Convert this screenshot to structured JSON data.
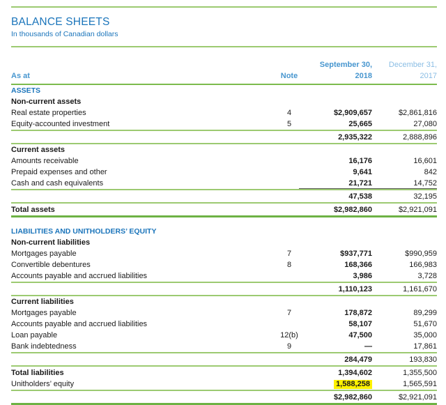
{
  "page": {
    "title": "BALANCE SHEETS",
    "subtitle": "In thousands of Canadian dollars"
  },
  "colors": {
    "accent_blue": "#1b75bb",
    "header_blue": "#4796cf",
    "header_blue_light": "#8abde4",
    "rule_green": "#9cca71",
    "rule_green_dark": "#6db244",
    "highlight_yellow": "#fff200",
    "text": "#1a1a1a"
  },
  "table": {
    "header": {
      "as_at": "As at",
      "note": "Note",
      "col_date_2018": "September 30,",
      "col_date_2017": "December 31,",
      "year_2018": "2018",
      "year_2017": "2017"
    },
    "rows": [
      {
        "type": "section",
        "label": "ASSETS"
      },
      {
        "type": "subhead",
        "label": "Non-current assets"
      },
      {
        "type": "item",
        "label": "Real estate properties",
        "note": "4",
        "v2018": "$2,909,657",
        "v2017": "$2,861,816"
      },
      {
        "type": "item",
        "label": "Equity-accounted investment",
        "note": "5",
        "v2018": "25,665",
        "v2017": "27,080"
      },
      {
        "type": "divider",
        "style": "thin"
      },
      {
        "type": "subtotal",
        "v2018": "2,935,322",
        "v2017": "2,888,896"
      },
      {
        "type": "divider",
        "style": "thin"
      },
      {
        "type": "subhead",
        "label": "Current assets"
      },
      {
        "type": "item",
        "label": "Amounts receivable",
        "v2018": "16,176",
        "v2017": "16,601"
      },
      {
        "type": "item",
        "label": "Prepaid expenses and other",
        "v2018": "9,641",
        "v2017": "842"
      },
      {
        "type": "item",
        "label": "Cash and cash equivalents",
        "v2018": "21,721",
        "v2017": "14,752"
      },
      {
        "type": "divider",
        "style": "thin-gray"
      },
      {
        "type": "subtotal",
        "v2018": "47,538",
        "v2017": "32,195"
      },
      {
        "type": "divider",
        "style": "thin"
      },
      {
        "type": "total",
        "label": "Total assets",
        "v2018": "$2,982,860",
        "v2017": "$2,921,091"
      },
      {
        "type": "divider",
        "style": "thick"
      },
      {
        "type": "spacer"
      },
      {
        "type": "section",
        "label": "LIABILITIES AND UNITHOLDERS’ EQUITY"
      },
      {
        "type": "subhead",
        "label": "Non-current liabilities"
      },
      {
        "type": "item",
        "label": "Mortgages payable",
        "note": "7",
        "v2018": "$937,771",
        "v2017": "$990,959"
      },
      {
        "type": "item",
        "label": "Convertible debentures",
        "note": "8",
        "v2018": "168,366",
        "v2017": "166,983"
      },
      {
        "type": "item",
        "label": "Accounts payable and accrued liabilities",
        "v2018": "3,986",
        "v2017": "3,728"
      },
      {
        "type": "divider",
        "style": "thin"
      },
      {
        "type": "subtotal",
        "v2018": "1,110,123",
        "v2017": "1,161,670"
      },
      {
        "type": "divider",
        "style": "thin"
      },
      {
        "type": "subhead",
        "label": "Current liabilities"
      },
      {
        "type": "item",
        "label": "Mortgages payable",
        "note": "7",
        "v2018": "178,872",
        "v2017": "89,299"
      },
      {
        "type": "item",
        "label": "Accounts payable and accrued liabilities",
        "v2018": "58,107",
        "v2017": "51,670"
      },
      {
        "type": "item",
        "label": "Loan payable",
        "note": "12(b)",
        "v2018": "47,500",
        "v2017": "35,000"
      },
      {
        "type": "item",
        "label": "Bank indebtedness",
        "note": "9",
        "v2018": "—",
        "v2017": "17,861"
      },
      {
        "type": "divider",
        "style": "thin"
      },
      {
        "type": "subtotal",
        "v2018": "284,479",
        "v2017": "193,830"
      },
      {
        "type": "divider",
        "style": "thin"
      },
      {
        "type": "total",
        "label": "Total liabilities",
        "v2018": "1,394,602",
        "v2017": "1,355,500"
      },
      {
        "type": "item",
        "label": "Unitholders’ equity",
        "v2018": "1,588,258",
        "v2017": "1,565,591",
        "highlight2018": true
      },
      {
        "type": "divider",
        "style": "thin"
      },
      {
        "type": "subtotal",
        "v2018": "$2,982,860",
        "v2017": "$2,921,091"
      },
      {
        "type": "divider",
        "style": "thick"
      }
    ]
  }
}
